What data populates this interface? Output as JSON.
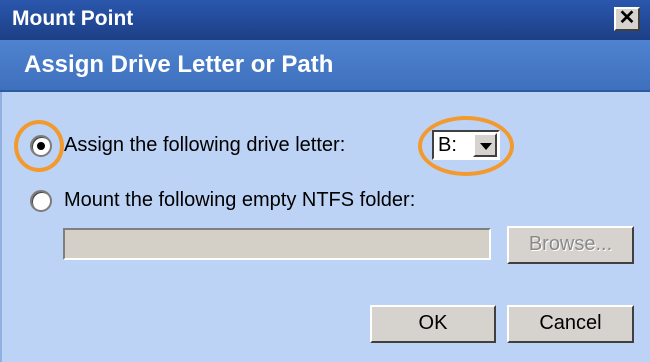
{
  "window": {
    "title": "Mount Point",
    "close_glyph": "✕"
  },
  "banner": {
    "heading": "Assign Drive Letter or Path"
  },
  "options": {
    "drive_letter_label": "Assign the following drive letter:",
    "drive_letter_selected": true,
    "ntfs_folder_label": "Mount the following empty NTFS folder:",
    "ntfs_folder_selected": false
  },
  "drive_select": {
    "value": "B:"
  },
  "folder_path": {
    "value": ""
  },
  "buttons": {
    "browse": "Browse...",
    "ok": "OK",
    "cancel": "Cancel"
  },
  "colors": {
    "highlight": "#f39a2e",
    "titlebar": "#1d3f86",
    "banner": "#4f83cf",
    "body": "#bcd3f5"
  }
}
